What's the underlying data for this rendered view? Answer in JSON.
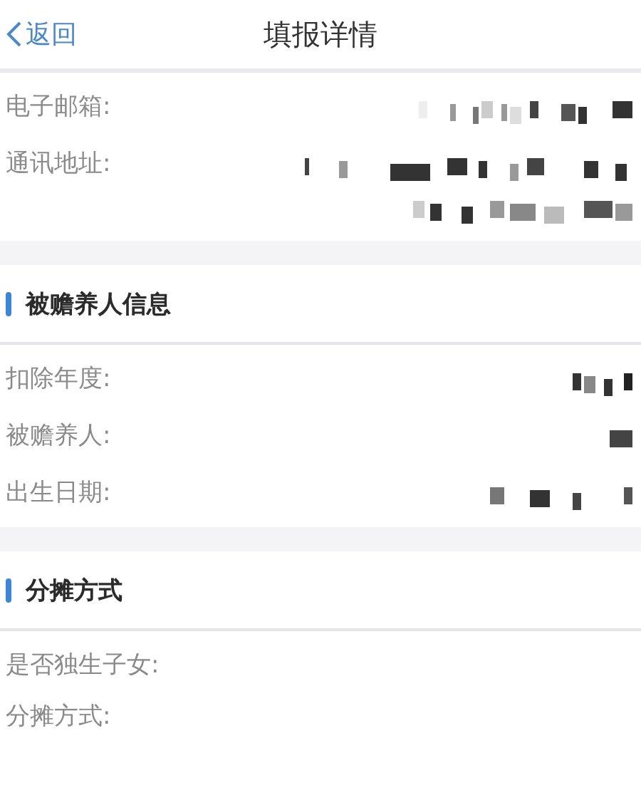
{
  "nav": {
    "back": "返回",
    "title": "填报详情"
  },
  "sections": [
    {
      "rows": [
        {
          "label": "电子邮箱:",
          "kind": "email"
        },
        {
          "label": "通讯地址:",
          "kind": "address"
        }
      ]
    },
    {
      "heading": "被赡养人信息",
      "rows": [
        {
          "label": "扣除年度:",
          "kind": "year"
        },
        {
          "label": "被赡养人:",
          "kind": "name"
        },
        {
          "label": "出生日期:",
          "kind": "date"
        }
      ]
    },
    {
      "heading": "分摊方式",
      "rows": [
        {
          "label": "是否独生子女:"
        },
        {
          "label": "分摊方式:"
        }
      ]
    }
  ]
}
